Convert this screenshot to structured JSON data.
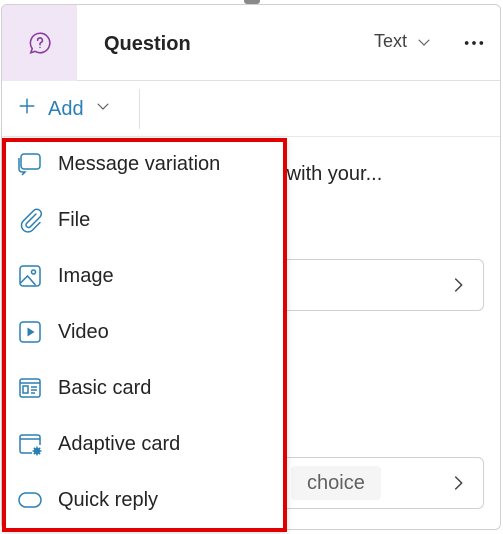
{
  "header": {
    "title": "Question",
    "type_value": "Text"
  },
  "toolbar": {
    "add_label": "Add"
  },
  "background": {
    "prompt_fragment": "o with your...",
    "choice_chip": "choice"
  },
  "menu": {
    "items": [
      {
        "label": "Message variation",
        "icon": "message-variation-icon"
      },
      {
        "label": "File",
        "icon": "paperclip-icon"
      },
      {
        "label": "Image",
        "icon": "image-icon"
      },
      {
        "label": "Video",
        "icon": "video-icon"
      },
      {
        "label": "Basic card",
        "icon": "basic-card-icon"
      },
      {
        "label": "Adaptive card",
        "icon": "adaptive-card-icon"
      },
      {
        "label": "Quick reply",
        "icon": "quick-reply-icon"
      }
    ]
  },
  "colors": {
    "accent": "#2a7fb4",
    "highlight_border": "#e00000",
    "badge_bg": "#f0e6f6",
    "badge_icon": "#8a3f9e"
  }
}
